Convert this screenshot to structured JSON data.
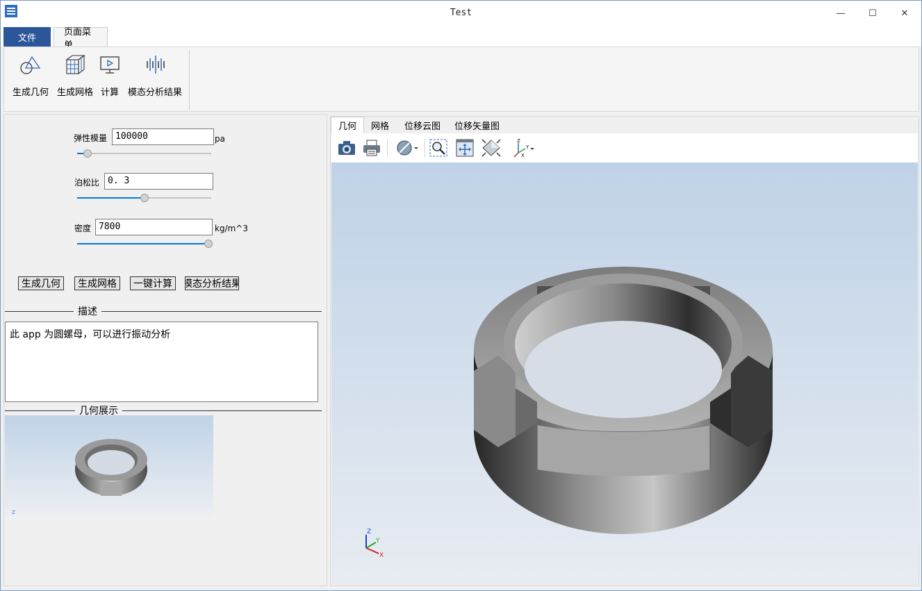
{
  "window": {
    "title": "Test",
    "minimize_glyph": "—",
    "maximize_glyph": "☐",
    "close_glyph": "✕"
  },
  "ribbon_tabs": [
    {
      "label": "文件"
    },
    {
      "label": "页面菜单"
    }
  ],
  "ribbon_buttons": [
    {
      "label": "生成几何",
      "icon": "geometry-icon"
    },
    {
      "label": "生成网格",
      "icon": "mesh-icon"
    },
    {
      "label": "计算",
      "icon": "compute-icon"
    },
    {
      "label": "模态分析结果",
      "icon": "modal-result-icon"
    }
  ],
  "params": {
    "elastic": {
      "label": "弹性模量",
      "value": "100000",
      "unit": "pa",
      "slider_fraction": 0.08
    },
    "poisson": {
      "label": "泊松比",
      "value": "0. 3",
      "slider_fraction": 0.5
    },
    "density": {
      "label": "密度",
      "value": "7800",
      "unit": "kg/m^3",
      "slider_fraction": 0.98
    }
  },
  "action_buttons": [
    "生成几何",
    "生成网格",
    "一键计算",
    "模态分析结果"
  ],
  "description": {
    "title": "描述",
    "text": "此 app 为圆螺母，可以进行振动分析"
  },
  "preview": {
    "title": "几何展示"
  },
  "view_tabs": [
    "几何",
    "网格",
    "位移云图",
    "位移矢量图"
  ],
  "toolbar_icons": [
    "camera-icon",
    "print-icon",
    "visibility-icon",
    "zoom-box-icon",
    "fit-view-icon",
    "view-cube-icon",
    "axes-icon"
  ],
  "axes": {
    "z": "Z",
    "y": "Y",
    "x": "X"
  },
  "colors": {
    "accent": "#2b579a",
    "slider_fill": "#0078d7",
    "viewport_top": "#bfd2e7",
    "viewport_bottom": "#e8ecf2"
  }
}
